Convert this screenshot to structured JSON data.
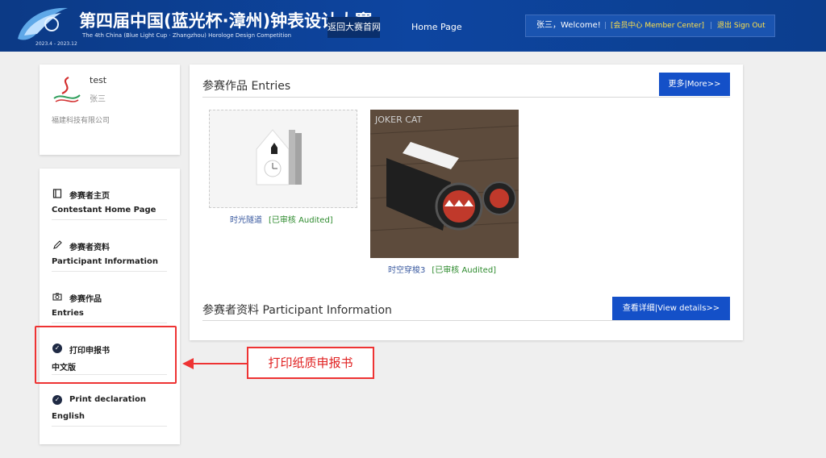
{
  "header": {
    "logo_years": "2023.4 - 2023.12",
    "title_cn": "第四届中国(蓝光杯·漳州)钟表设计大赛",
    "title_en": "The 4th China (Blue Light Cup · Zhangzhou) Horologe Design Competition",
    "nav_back": "返回大赛首网",
    "nav_home": "Home Page",
    "welcome": "张三，Welcome!",
    "member_center": "[会员中心 Member Center]",
    "sign_out": "退出 Sign Out"
  },
  "profile": {
    "name": "test",
    "name_cn": "张三",
    "company": "福建科技有限公司"
  },
  "menu": [
    {
      "line1": "参赛者主页",
      "line2": "Contestant Home Page",
      "icon": "book-icon"
    },
    {
      "line1": "参赛者资料",
      "line2": "Participant Information",
      "icon": "pencil-icon"
    },
    {
      "line1": "参赛作品",
      "line2": "Entries",
      "icon": "camera-icon"
    },
    {
      "line1": "打印申报书",
      "line2": "中文版",
      "icon": "check-circle-icon"
    },
    {
      "line1": "Print declaration",
      "line2": "English",
      "icon": "check-circle-icon"
    }
  ],
  "callout": "打印纸质申报书",
  "entries_section": {
    "title": "参赛作品 Entries",
    "more_label": "更多|More>>",
    "items": [
      {
        "name": "时光隧道",
        "status": "[已审核 Audited]"
      },
      {
        "name": "时空穿梭3",
        "status": "[已审核 Audited]"
      }
    ],
    "brand_text": "JOKER CAT"
  },
  "participant_section": {
    "title": "参赛者资料 Participant Information",
    "details_label": "查看详细|View details>>"
  },
  "colors": {
    "header_bg": "#0d45a0",
    "primary_button": "#1450c8",
    "highlight_red": "#e33333",
    "audited_green": "#2e8b2e"
  }
}
